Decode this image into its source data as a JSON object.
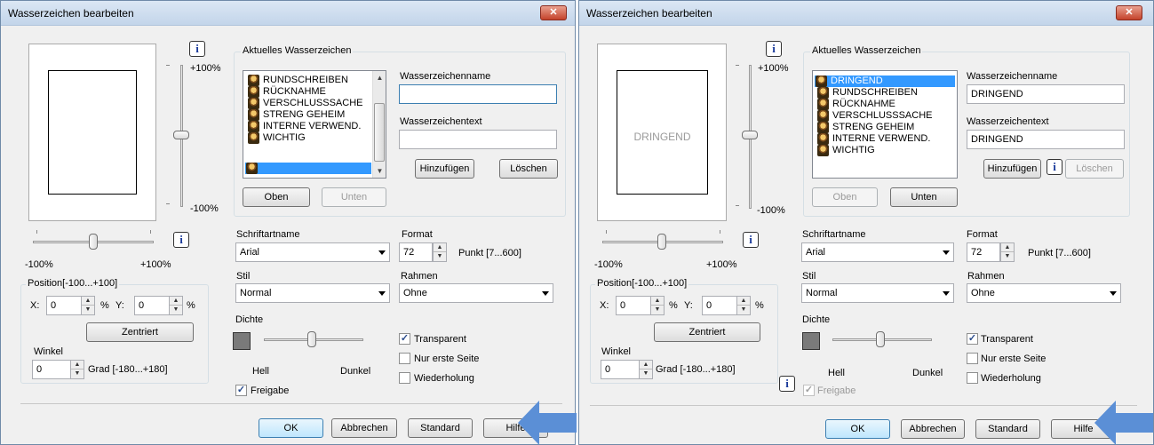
{
  "left": {
    "title": "Wasserzeichen bearbeiten",
    "close": "✕",
    "info_icon": "i",
    "vslider_top_label": "+100%",
    "vslider_bottom_label": "-100%",
    "hslider_left_label": "-100%",
    "hslider_right_label": "+100%",
    "current_group_label": "Aktuelles Wasserzeichen",
    "list_items": [
      "RUNDSCHREIBEN",
      "RÜCKNAHME",
      "VERSCHLUSSSACHE",
      "STRENG GEHEIM",
      "INTERNE VERWEND.",
      "WICHTIG",
      ""
    ],
    "selected_index": 6,
    "oben_label": "Oben",
    "unten_label": "Unten",
    "name_label": "Wasserzeichenname",
    "name_value": "",
    "text_label": "Wasserzeichentext",
    "text_value": "",
    "add_label": "Hinzufügen",
    "delete_label": "Löschen",
    "position_label": "Position[-100...+100]",
    "x_label": "X:",
    "x_value": "0",
    "percent": "%",
    "y_label": "Y:",
    "y_value": "0",
    "center_label": "Zentriert",
    "angle_label": "Winkel",
    "angle_value": "0",
    "angle_unit": "Grad [-180...+180]",
    "font_label": "Schriftartname",
    "font_value": "Arial",
    "style_label": "Stil",
    "style_value": "Normal",
    "density_label": "Dichte",
    "light_label": "Hell",
    "dark_label": "Dunkel",
    "release_label": "Freigabe",
    "release_checked": true,
    "format_label": "Format",
    "format_value": "72",
    "format_unit": "Punkt [7...600]",
    "frame_label": "Rahmen",
    "frame_value": "Ohne",
    "transparent_label": "Transparent",
    "transparent_checked": true,
    "first_page_label": "Nur erste Seite",
    "first_page_checked": false,
    "repeat_label": "Wiederholung",
    "repeat_checked": false,
    "ok_label": "OK",
    "cancel_label": "Abbrechen",
    "standard_label": "Standard",
    "help_label": "Hilfe",
    "preview_text": ""
  },
  "right": {
    "title": "Wasserzeichen bearbeiten",
    "close": "✕",
    "info_icon": "i",
    "vslider_top_label": "+100%",
    "vslider_bottom_label": "-100%",
    "hslider_left_label": "-100%",
    "hslider_right_label": "+100%",
    "current_group_label": "Aktuelles Wasserzeichen",
    "list_items": [
      "DRINGEND",
      "RUNDSCHREIBEN",
      "RÜCKNAHME",
      "VERSCHLUSSSACHE",
      "STRENG GEHEIM",
      "INTERNE VERWEND.",
      "WICHTIG"
    ],
    "selected_index": 0,
    "oben_label": "Oben",
    "unten_label": "Unten",
    "name_label": "Wasserzeichenname",
    "name_value": "DRINGEND",
    "text_label": "Wasserzeichentext",
    "text_value": "DRINGEND",
    "add_label": "Hinzufügen",
    "delete_label": "Löschen",
    "position_label": "Position[-100...+100]",
    "x_label": "X:",
    "x_value": "0",
    "percent": "%",
    "y_label": "Y:",
    "y_value": "0",
    "center_label": "Zentriert",
    "angle_label": "Winkel",
    "angle_value": "0",
    "angle_unit": "Grad [-180...+180]",
    "font_label": "Schriftartname",
    "font_value": "Arial",
    "style_label": "Stil",
    "style_value": "Normal",
    "density_label": "Dichte",
    "light_label": "Hell",
    "dark_label": "Dunkel",
    "release_label": "Freigabe",
    "release_checked": true,
    "format_label": "Format",
    "format_value": "72",
    "format_unit": "Punkt [7...600]",
    "frame_label": "Rahmen",
    "frame_value": "Ohne",
    "transparent_label": "Transparent",
    "transparent_checked": true,
    "first_page_label": "Nur erste Seite",
    "first_page_checked": false,
    "repeat_label": "Wiederholung",
    "repeat_checked": false,
    "ok_label": "OK",
    "cancel_label": "Abbrechen",
    "standard_label": "Standard",
    "help_label": "Hilfe",
    "preview_text": "DRINGEND"
  },
  "colors": {
    "selection": "#3399ff",
    "arrow": "#5b8fd6",
    "close_button": "#c4432b"
  }
}
